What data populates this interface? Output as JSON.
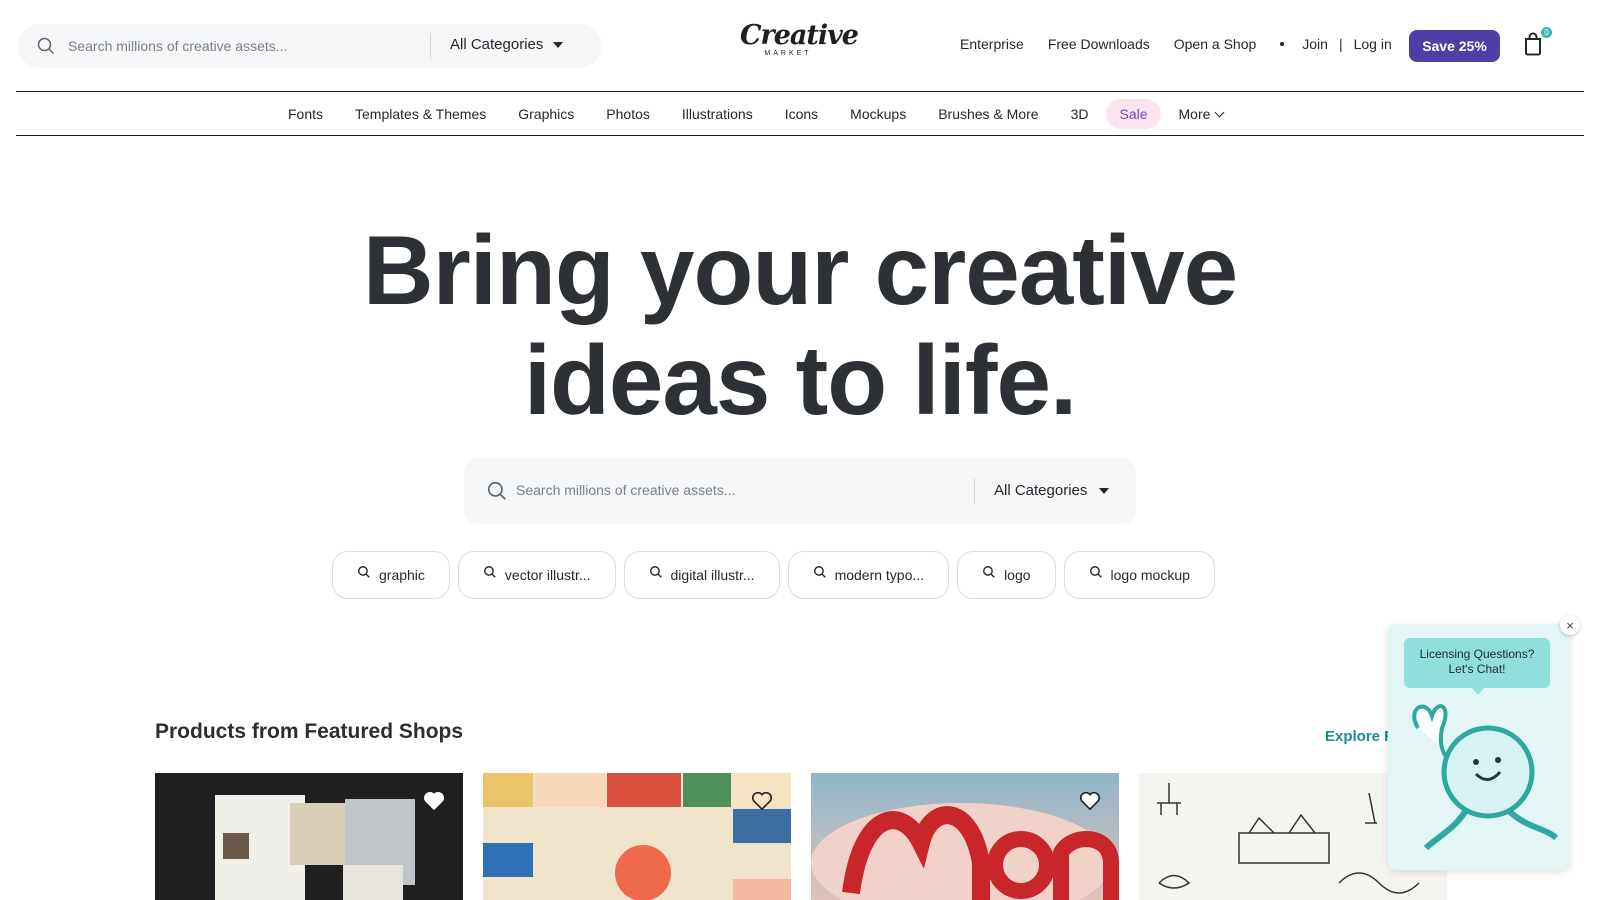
{
  "header": {
    "search_placeholder": "Search millions of creative assets...",
    "category_label": "All Categories",
    "logo_text": "Creative",
    "logo_subtext": "MARKET",
    "links": [
      "Enterprise",
      "Free Downloads",
      "Open a Shop"
    ],
    "join_label": "Join",
    "separator": "|",
    "login_label": "Log in",
    "save_label": "Save 25%",
    "cart_count": "0"
  },
  "nav": {
    "items": [
      "Fonts",
      "Templates & Themes",
      "Graphics",
      "Photos",
      "Illustrations",
      "Icons",
      "Mockups",
      "Brushes & More",
      "3D"
    ],
    "sale_label": "Sale",
    "more_label": "More"
  },
  "hero": {
    "title_line1": "Bring your creative",
    "title_line2": "ideas to life.",
    "search_placeholder": "Search millions of creative assets...",
    "category_label": "All Categories",
    "chips": [
      "graphic",
      "vector illustr...",
      "digital illustr...",
      "modern typo...",
      "logo",
      "logo mockup"
    ]
  },
  "featured": {
    "title": "Products from Featured Shops",
    "explore_label": "Explore F"
  },
  "chat": {
    "line1": "Licensing Questions?",
    "line2": "Let's Chat!",
    "close_glyph": "×"
  },
  "colors": {
    "accent": "#4f3ea5",
    "teal": "#1e8c8c",
    "sale_bg": "#fbe4ef"
  }
}
